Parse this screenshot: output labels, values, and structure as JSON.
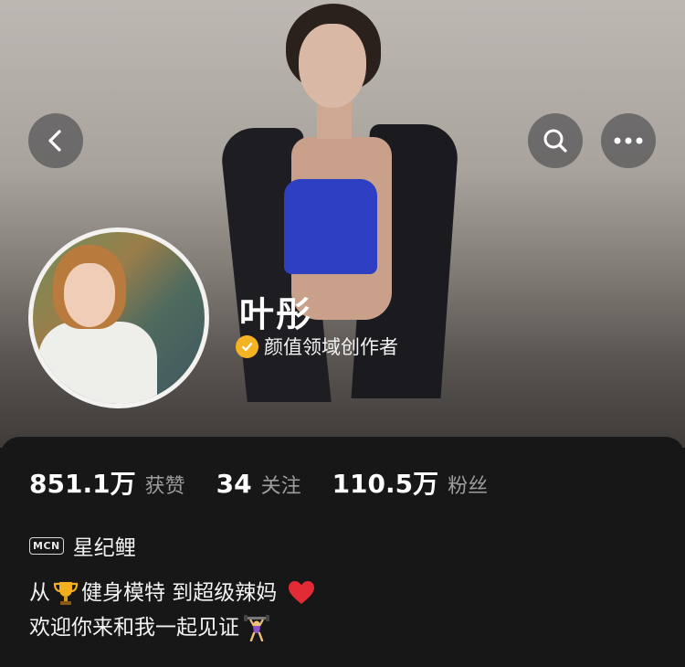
{
  "profile": {
    "name": "叶彤",
    "creator_label": "颜值领域创作者",
    "badge_color": "#f4b322"
  },
  "stats": [
    {
      "value": "851.1万",
      "label": "获赞"
    },
    {
      "value": "34",
      "label": "关注"
    },
    {
      "value": "110.5万",
      "label": "粉丝"
    }
  ],
  "mcn": {
    "tag": "MCN",
    "name": "星纪鲤"
  },
  "bio": {
    "line1_a": "从",
    "line1_b": "健身模特  到超级辣妈",
    "line2": "欢迎你来和我一起见证",
    "emoji": [
      "trophy-icon",
      "heart-icon",
      "weightlifter-icon"
    ]
  },
  "icons": {
    "back": "back-arrow-icon",
    "search": "search-icon",
    "more": "more-dots-icon"
  }
}
